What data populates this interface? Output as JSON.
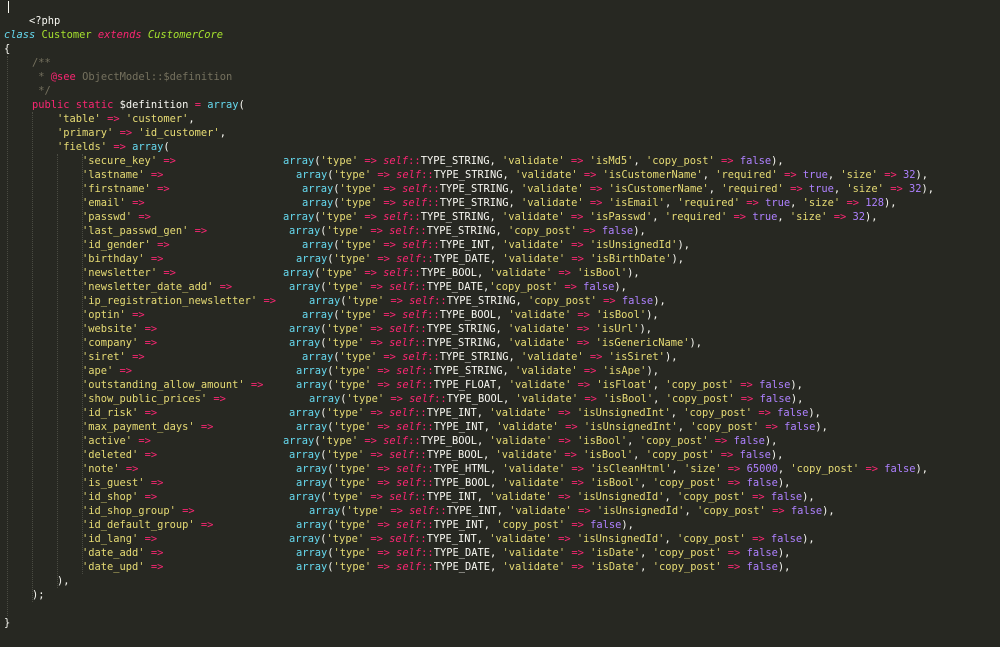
{
  "code": {
    "open_tag": "<?php",
    "class_decl": {
      "class_kw": "class",
      "name": "Customer",
      "extends_kw": "extends",
      "parent": "CustomerCore"
    },
    "brace_open": "{",
    "brace_close": "}",
    "doc_comment": {
      "open": "/**",
      "see_tag": "@see",
      "see_text": "ObjectModel::$definition",
      "close": "*/"
    },
    "definition": {
      "modifiers": "public static",
      "variable": "$definition",
      "assign": "=",
      "array_fn": "array",
      "table_key": "'table'",
      "table_value": "'customer'",
      "primary_key": "'primary'",
      "primary_value": "'id_customer'",
      "fields_key": "'fields'",
      "fields_close": "),",
      "array_close": ");"
    },
    "fields": [
      {
        "key": "'secure_key'",
        "type": "TYPE_STRING",
        "opts": [
          [
            "'validate'",
            "'isMd5'"
          ],
          [
            "'copy_post'",
            "false"
          ]
        ]
      },
      {
        "key": "'lastname'",
        "type": "TYPE_STRING",
        "opts": [
          [
            "'validate'",
            "'isCustomerName'"
          ],
          [
            "'required'",
            "true"
          ],
          [
            "'size'",
            "32"
          ]
        ]
      },
      {
        "key": "'firstname'",
        "type": "TYPE_STRING",
        "opts": [
          [
            "'validate'",
            "'isCustomerName'"
          ],
          [
            "'required'",
            "true"
          ],
          [
            "'size'",
            "32"
          ]
        ]
      },
      {
        "key": "'email'",
        "type": "TYPE_STRING",
        "opts": [
          [
            "'validate'",
            "'isEmail'"
          ],
          [
            "'required'",
            "true"
          ],
          [
            "'size'",
            "128"
          ]
        ]
      },
      {
        "key": "'passwd'",
        "type": "TYPE_STRING",
        "opts": [
          [
            "'validate'",
            "'isPasswd'"
          ],
          [
            "'required'",
            "true"
          ],
          [
            "'size'",
            "32"
          ]
        ]
      },
      {
        "key": "'last_passwd_gen'",
        "type": "TYPE_STRING",
        "opts": [
          [
            "'copy_post'",
            "false"
          ]
        ]
      },
      {
        "key": "'id_gender'",
        "type": "TYPE_INT",
        "opts": [
          [
            "'validate'",
            "'isUnsignedId'"
          ]
        ]
      },
      {
        "key": "'birthday'",
        "type": "TYPE_DATE",
        "opts": [
          [
            "'validate'",
            "'isBirthDate'"
          ]
        ]
      },
      {
        "key": "'newsletter'",
        "type": "TYPE_BOOL",
        "opts": [
          [
            "'validate'",
            "'isBool'"
          ]
        ]
      },
      {
        "key": "'newsletter_date_add'",
        "type": "TYPE_DATE",
        "opts": [
          [
            "'copy_post'",
            "false"
          ]
        ],
        "tight": true
      },
      {
        "key": "'ip_registration_newsletter'",
        "type": "TYPE_STRING",
        "opts": [
          [
            "'copy_post'",
            "false"
          ]
        ]
      },
      {
        "key": "'optin'",
        "type": "TYPE_BOOL",
        "opts": [
          [
            "'validate'",
            "'isBool'"
          ]
        ]
      },
      {
        "key": "'website'",
        "type": "TYPE_STRING",
        "opts": [
          [
            "'validate'",
            "'isUrl'"
          ]
        ]
      },
      {
        "key": "'company'",
        "type": "TYPE_STRING",
        "opts": [
          [
            "'validate'",
            "'isGenericName'"
          ]
        ]
      },
      {
        "key": "'siret'",
        "type": "TYPE_STRING",
        "opts": [
          [
            "'validate'",
            "'isSiret'"
          ]
        ]
      },
      {
        "key": "'ape'",
        "type": "TYPE_STRING",
        "opts": [
          [
            "'validate'",
            "'isApe'"
          ]
        ]
      },
      {
        "key": "'outstanding_allow_amount'",
        "type": "TYPE_FLOAT",
        "opts": [
          [
            "'validate'",
            "'isFloat'"
          ],
          [
            "'copy_post'",
            "false"
          ]
        ]
      },
      {
        "key": "'show_public_prices'",
        "type": "TYPE_BOOL",
        "opts": [
          [
            "'validate'",
            "'isBool'"
          ],
          [
            "'copy_post'",
            "false"
          ]
        ]
      },
      {
        "key": "'id_risk'",
        "type": "TYPE_INT",
        "opts": [
          [
            "'validate'",
            "'isUnsignedInt'"
          ],
          [
            "'copy_post'",
            "false"
          ]
        ]
      },
      {
        "key": "'max_payment_days'",
        "type": "TYPE_INT",
        "opts": [
          [
            "'validate'",
            "'isUnsignedInt'"
          ],
          [
            "'copy_post'",
            "false"
          ]
        ]
      },
      {
        "key": "'active'",
        "type": "TYPE_BOOL",
        "opts": [
          [
            "'validate'",
            "'isBool'"
          ],
          [
            "'copy_post'",
            "false"
          ]
        ]
      },
      {
        "key": "'deleted'",
        "type": "TYPE_BOOL",
        "opts": [
          [
            "'validate'",
            "'isBool'"
          ],
          [
            "'copy_post'",
            "false"
          ]
        ]
      },
      {
        "key": "'note'",
        "type": "TYPE_HTML",
        "opts": [
          [
            "'validate'",
            "'isCleanHtml'"
          ],
          [
            "'size'",
            "65000"
          ],
          [
            "'copy_post'",
            "false"
          ]
        ]
      },
      {
        "key": "'is_guest'",
        "type": "TYPE_BOOL",
        "opts": [
          [
            "'validate'",
            "'isBool'"
          ],
          [
            "'copy_post'",
            "false"
          ]
        ]
      },
      {
        "key": "'id_shop'",
        "type": "TYPE_INT",
        "opts": [
          [
            "'validate'",
            "'isUnsignedId'"
          ],
          [
            "'copy_post'",
            "false"
          ]
        ]
      },
      {
        "key": "'id_shop_group'",
        "type": "TYPE_INT",
        "opts": [
          [
            "'validate'",
            "'isUnsignedId'"
          ],
          [
            "'copy_post'",
            "false"
          ]
        ]
      },
      {
        "key": "'id_default_group'",
        "type": "TYPE_INT",
        "opts": [
          [
            "'copy_post'",
            "false"
          ]
        ]
      },
      {
        "key": "'id_lang'",
        "type": "TYPE_INT",
        "opts": [
          [
            "'validate'",
            "'isUnsignedId'"
          ],
          [
            "'copy_post'",
            "false"
          ]
        ]
      },
      {
        "key": "'date_add'",
        "type": "TYPE_DATE",
        "opts": [
          [
            "'validate'",
            "'isDate'"
          ],
          [
            "'copy_post'",
            "false"
          ]
        ]
      },
      {
        "key": "'date_upd'",
        "type": "TYPE_DATE",
        "opts": [
          [
            "'validate'",
            "'isDate'"
          ],
          [
            "'copy_post'",
            "false"
          ]
        ]
      }
    ]
  }
}
